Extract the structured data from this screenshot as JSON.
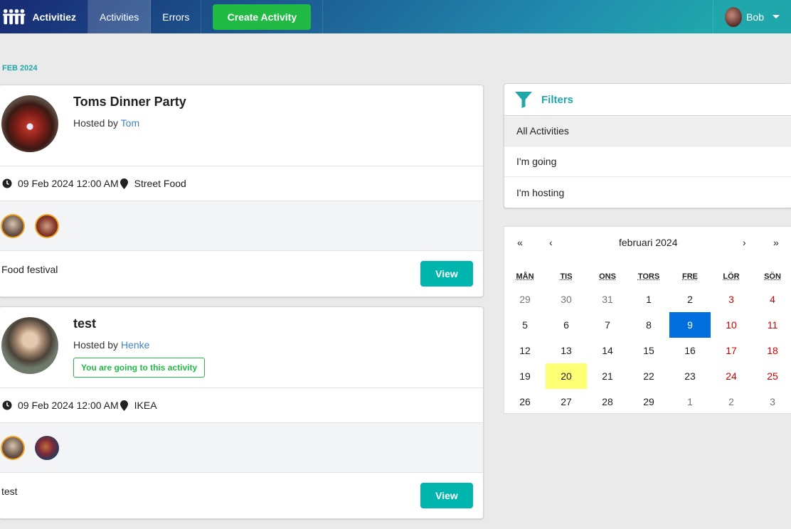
{
  "nav": {
    "brand": "Activitiez",
    "items": [
      "Activities",
      "Errors"
    ],
    "create_label": "Create Activity",
    "user": "Bob"
  },
  "month_label": "FEB 2024",
  "activities": [
    {
      "title": "Toms Dinner Party",
      "hosted_prefix": "Hosted by ",
      "host": "Tom",
      "going_label": "",
      "date": "09 Feb 2024 12:00 AM",
      "venue": "Street Food",
      "description": "Food festival",
      "view_label": "View"
    },
    {
      "title": "test",
      "hosted_prefix": "Hosted by ",
      "host": "Henke",
      "going_label": "You are going to this activity",
      "date": "09 Feb 2024 12:00 AM",
      "venue": "IKEA",
      "description": "test",
      "view_label": "View"
    }
  ],
  "filters": {
    "title": "Filters",
    "items": [
      "All Activities",
      "I'm going",
      "I'm hosting"
    ],
    "active": "All Activities"
  },
  "calendar": {
    "prev2": "«",
    "prev": "‹",
    "label": "februari 2024",
    "next": "›",
    "next2": "»",
    "weekdays": [
      "MÅN",
      "TIS",
      "ONS",
      "TORS",
      "FRE",
      "LÖR",
      "SÖN"
    ],
    "weeks": [
      [
        "29",
        "30",
        "31",
        "1",
        "2",
        "3",
        "4"
      ],
      [
        "5",
        "6",
        "7",
        "8",
        "9",
        "10",
        "11"
      ],
      [
        "12",
        "13",
        "14",
        "15",
        "16",
        "17",
        "18"
      ],
      [
        "19",
        "20",
        "21",
        "22",
        "23",
        "24",
        "25"
      ],
      [
        "26",
        "27",
        "28",
        "29",
        "1",
        "2",
        "3"
      ]
    ],
    "selected": "9",
    "today": "20"
  },
  "colors": {
    "accent": "#20a7ac",
    "green": "#21ba45",
    "teal": "#00b5ad",
    "weekend": "#d10000",
    "selected": "#006edc",
    "today": "#ffff76"
  }
}
